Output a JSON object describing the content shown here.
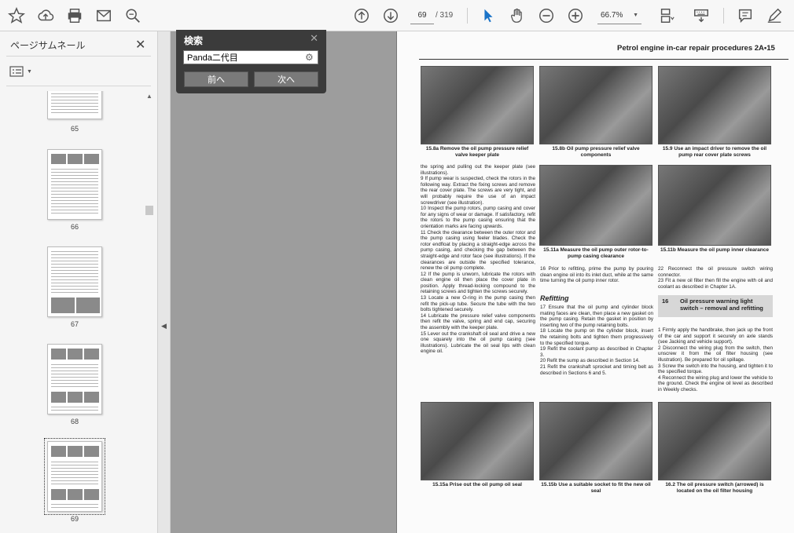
{
  "toolbar": {
    "page_current": "69",
    "page_total": "/ 319",
    "zoom": "66.7%"
  },
  "sidebar": {
    "title": "ページサムネール",
    "thumbs": [
      {
        "label": "65"
      },
      {
        "label": "66"
      },
      {
        "label": "67"
      },
      {
        "label": "68"
      },
      {
        "label": "69"
      }
    ]
  },
  "search": {
    "title": "検索",
    "query": "Panda二代目",
    "prev_label": "前へ",
    "next_label": "次へ"
  },
  "document": {
    "header": "Petrol engine in-car repair procedures 2A•15",
    "captions": [
      "15.8a Remove the oil pump pressure relief valve keeper plate",
      "15.8b Oil pump pressure relief valve components",
      "15.9 Use an impact driver to remove the oil pump rear cover plate screws",
      "15.11a Measure the oil pump outer rotor-to-pump casing clearance",
      "15.11b Measure the oil pump inner clearance",
      "15.15a Prise out the oil pump oil seal",
      "15.15b Use a suitable socket to fit the new oil seal",
      "16.2 The oil pressure switch (arrowed) is located on the oil filter housing"
    ],
    "col1_text": "the spring and pulling out the keeper plate (see illustrations).\n9 If pump wear is suspected, check the rotors in the following way. Extract the fixing screws and remove the rear cover plate. The screws are very tight, and will probably require the use of an impact screwdriver (see illustration).\n10 Inspect the pump rotors, pump casing and cover for any signs of wear or damage. If satisfactory, refit the rotors to the pump casing ensuring that the orientation marks are facing upwards.\n11 Check the clearance between the outer rotor and the pump casing using feeler blades. Check the rotor endfloat by placing a straight-edge across the pump casing, and checking the gap between the straight-edge and rotor face (see illustrations). If the clearances are outside the specified tolerance, renew the oil pump complete.\n12 If the pump is unworn, lubricate the rotors with clean engine oil then place the cover plate in position. Apply thread-locking compound to the retaining screws and tighten the screws securely.\n13 Locate a new O-ring in the pump casing then refit the pick-up tube. Secure the tube with the two bolts tightened securely.\n14 Lubricate the pressure relief valve components then refit the valve, spring and end cap, securing the assembly with the keeper plate.\n15 Lever out the crankshaft oil seal and drive a new one squarely into the oil pump casing (see illustrations). Lubricate the oil seal lips with clean engine oil.",
    "col2_text_a": "16 Prior to refitting, prime the pump by pouring clean engine oil into its inlet duct, while at the same time turning the oil pump inner rotor.",
    "refitting_heading": "Refitting",
    "col2_text_b": "17 Ensure that the oil pump and cylinder block mating faces are clean, then place a new gasket on the pump casing. Retain the gasket in position by inserting two of the pump retaining bolts.\n18 Locate the pump on the cylinder block, insert the retaining bolts and tighten them progressively to the specified torque.\n19 Refit the coolant pump as described in Chapter 3.\n20 Refit the sump as described in Section 14.\n21 Refit the crankshaft sprocket and timing belt as described in Sections 6 and 5.",
    "col3_text_a": "22 Reconnect the oil pressure switch wiring connector.\n23 Fit a new oil filter then fill the engine with oil and coolant as described in Chapter 1A.",
    "section_number": "16",
    "section_title": "Oil pressure warning light switch – removal and refitting",
    "col3_text_b": "1 Firmly apply the handbrake, then jack up the front of the car and support it securely on axle stands (see Jacking and vehicle support).\n2 Disconnect the wiring plug from the switch, then unscrew it from the oil filter housing (see illustration). Be prepared for oil spillage.\n3 Screw the switch into the housing, and tighten it to the specified torque.\n4 Reconnect the wiring plug and lower the vehicle to the ground. Check the engine oil level as described in Weekly checks."
  },
  "colors": {
    "toolbar_bg": "#f7f7f7",
    "accent_blue": "#1a73c8",
    "search_panel_bg": "#3b3b3b"
  }
}
